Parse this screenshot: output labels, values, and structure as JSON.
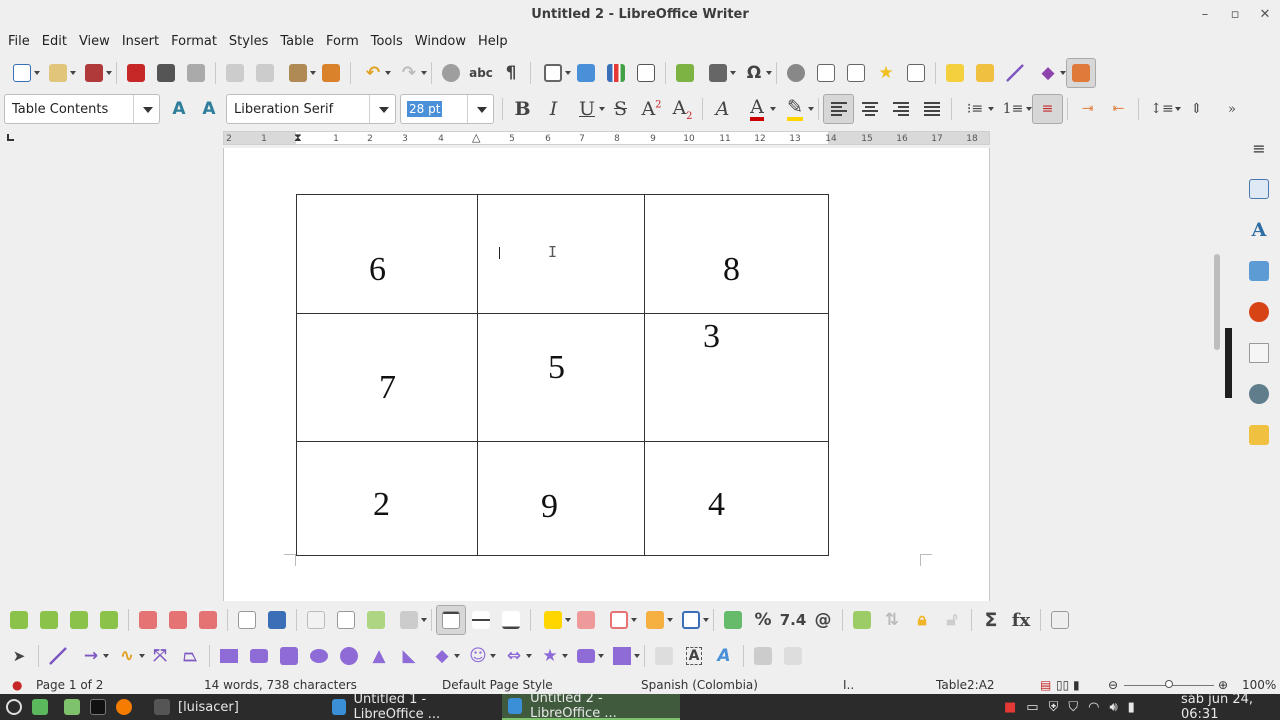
{
  "window": {
    "title": "Untitled 2 - LibreOffice Writer"
  },
  "menu": [
    "File",
    "Edit",
    "View",
    "Insert",
    "Format",
    "Styles",
    "Table",
    "Form",
    "Tools",
    "Window",
    "Help"
  ],
  "formatting": {
    "paragraph_style": "Table Contents",
    "font_name": "Liberation Serif",
    "font_size": "28 pt"
  },
  "ruler": {
    "ticks": [
      "2",
      "1",
      "1",
      "2",
      "3",
      "4",
      "5",
      "6",
      "7",
      "8",
      "9",
      "10",
      "11",
      "12",
      "13",
      "14",
      "15",
      "16",
      "17",
      "18"
    ]
  },
  "table": {
    "rows": [
      [
        "6",
        "",
        "8"
      ],
      [
        "7",
        "5",
        "3"
      ],
      [
        "2",
        "9",
        "4"
      ]
    ]
  },
  "toolbar_glyphs": {
    "omega": "Ω",
    "bold": "B",
    "italic": "I",
    "underline": "U",
    "strike": "S",
    "percent": "%",
    "number_format": "7.4",
    "sum": "Σ",
    "formula": "fx"
  },
  "statusbar": {
    "page": "Page 1 of 2",
    "words": "14 words, 738 characters",
    "page_style": "Default Page Style",
    "language": "Spanish (Colombia)",
    "selection_mode": "I..",
    "cell_ref": "Table2:A2",
    "zoom": "100%"
  },
  "taskbar": {
    "items": [
      "[luisacer]",
      "Untitled 1 - LibreOffice ...",
      "Untitled 2 - LibreOffice ..."
    ],
    "clock": "sáb jun 24, 06:31"
  },
  "colors": {
    "accent_blue": "#4a90d9",
    "font_color_red": "#cc0000",
    "highlight_yellow": "#ffd600",
    "taskbar_active": "#3f5a3d"
  }
}
